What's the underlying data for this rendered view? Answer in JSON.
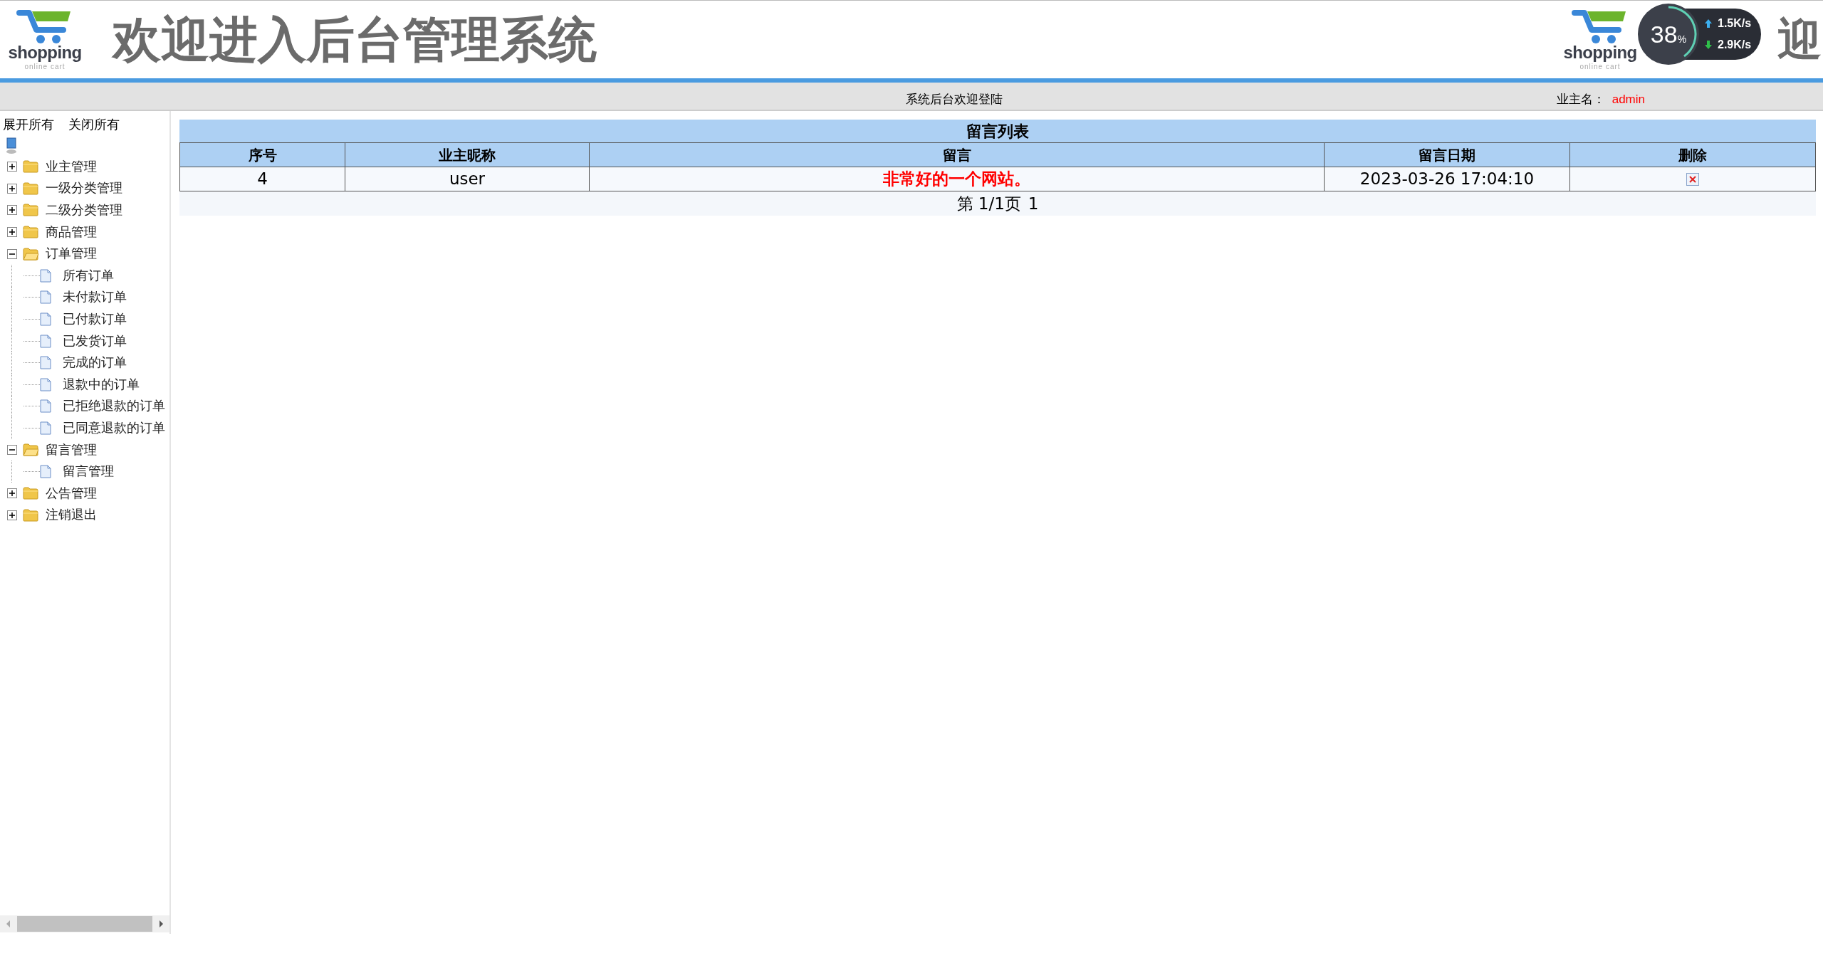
{
  "header": {
    "logo": {
      "name": "shopping",
      "tagline": "online cart"
    },
    "title": "欢迎进入后台管理系统",
    "repeat": {
      "logo": {
        "name": "shopping",
        "tagline": "online cart"
      },
      "title": "迎"
    },
    "net_widget": {
      "percent": "38",
      "unit": "%",
      "up": "1.5K/s",
      "down": "2.9K/s"
    }
  },
  "nav_bar": {
    "center": "系统后台欢迎登陆",
    "user_label": "业主名：",
    "user_name": "admin"
  },
  "sidebar": {
    "actions": [
      "展开所有",
      "关闭所有"
    ],
    "tree": [
      {
        "label": "业主管理",
        "expanded": false
      },
      {
        "label": "一级分类管理",
        "expanded": false
      },
      {
        "label": "二级分类管理",
        "expanded": false
      },
      {
        "label": "商品管理",
        "expanded": false
      },
      {
        "label": "订单管理",
        "expanded": true,
        "children": [
          {
            "label": "所有订单"
          },
          {
            "label": "未付款订单"
          },
          {
            "label": "已付款订单"
          },
          {
            "label": "已发货订单"
          },
          {
            "label": "完成的订单"
          },
          {
            "label": "退款中的订单"
          },
          {
            "label": "已拒绝退款的订单"
          },
          {
            "label": "已同意退款的订单"
          }
        ]
      },
      {
        "label": "留言管理",
        "expanded": true,
        "children": [
          {
            "label": "留言管理"
          }
        ]
      },
      {
        "label": "公告管理",
        "expanded": false
      },
      {
        "label": "注销退出",
        "expanded": false
      }
    ]
  },
  "table": {
    "title": "留言列表",
    "columns": [
      "序号",
      "业主昵称",
      "留言",
      "留言日期",
      "删除"
    ],
    "rows": [
      {
        "cells": [
          "4",
          "user",
          "非常好的一个网站。",
          "2023-03-26 17:04:10"
        ]
      }
    ],
    "pagination": {
      "text": "第 1/1页",
      "page": "1"
    }
  }
}
